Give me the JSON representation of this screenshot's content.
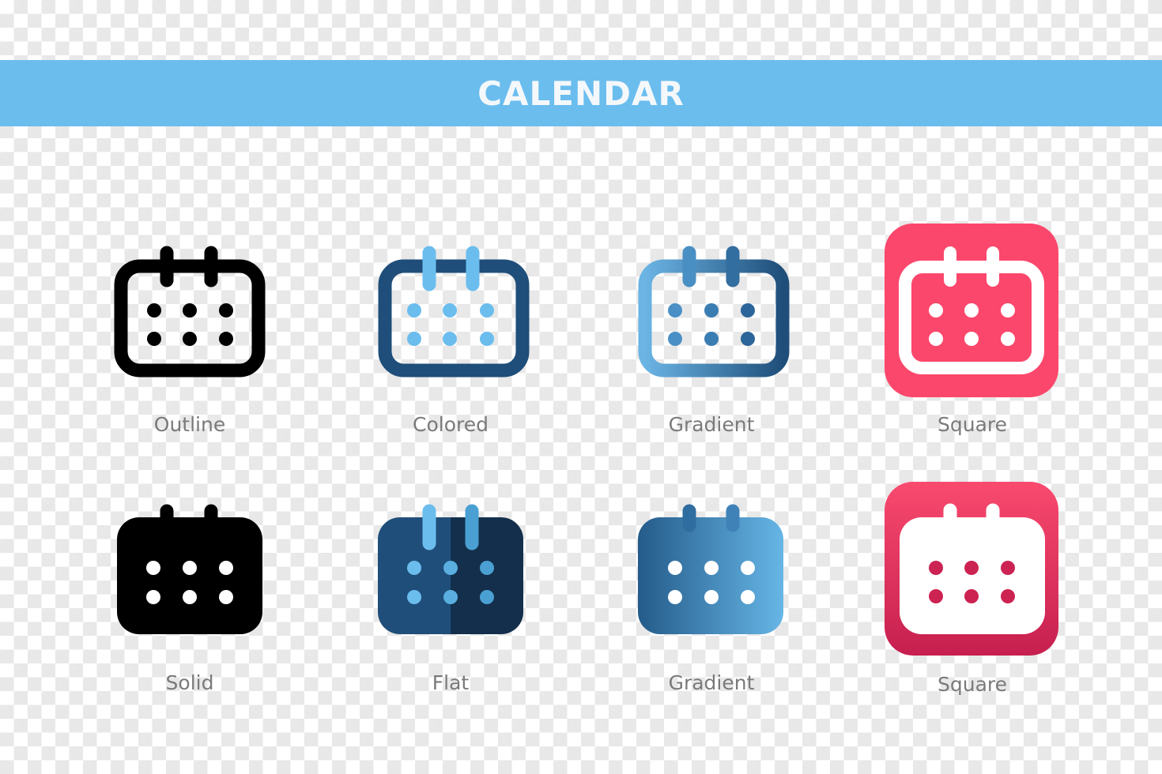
{
  "header": {
    "title": "CALENDAR",
    "background_color": "#6bbdee"
  },
  "icons": [
    {
      "style": "outline",
      "label": "Outline",
      "colors": {
        "stroke": "#000000",
        "dots": "#000000"
      }
    },
    {
      "style": "colored",
      "label": "Colored",
      "colors": {
        "stroke": "#1f4e7a",
        "accent": "#6bbdee"
      }
    },
    {
      "style": "gradient-outline",
      "label": "Gradient",
      "colors": {
        "from": "#6bb4e4",
        "to": "#1f4e7a"
      }
    },
    {
      "style": "square-outline",
      "label": "Square",
      "colors": {
        "background": "#fb476c",
        "foreground": "#ffffff"
      }
    },
    {
      "style": "solid",
      "label": "Solid",
      "colors": {
        "fill": "#000000",
        "dots": "#ffffff"
      }
    },
    {
      "style": "flat",
      "label": "Flat",
      "colors": {
        "left": "#1f4e7a",
        "right": "#132f4c",
        "accent_left": "#6bbdee",
        "accent_right": "#4aa0d2"
      }
    },
    {
      "style": "gradient-solid",
      "label": "Gradient",
      "colors": {
        "from": "#245b8a",
        "to": "#66b6e6",
        "dots": "#ffffff"
      }
    },
    {
      "style": "square-solid",
      "label": "Square",
      "colors": {
        "top": "#f94a6e",
        "bottom": "#c61f4f",
        "foreground": "#ffffff",
        "dots": "#cc2352"
      }
    }
  ]
}
